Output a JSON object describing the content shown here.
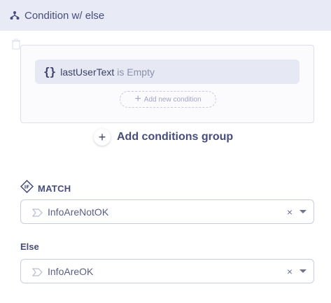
{
  "header": {
    "title": "Condition w/ else",
    "icon": "split-icon"
  },
  "conditions_group": {
    "condition": {
      "variable": "lastUserText",
      "operator": "is Empty",
      "icon": "braces-icon"
    },
    "add_condition_label": "Add new condition"
  },
  "add_group_label": "Add conditions group",
  "match": {
    "label": "MATCH",
    "value": "InfoAreNotOK",
    "clear_symbol": "×"
  },
  "else": {
    "label": "Else",
    "value": "InfoAreOK",
    "clear_symbol": "×"
  },
  "colors": {
    "header_bg": "#e8ebf6",
    "text": "#474d7a",
    "row_bg": "#e6e9f4"
  }
}
